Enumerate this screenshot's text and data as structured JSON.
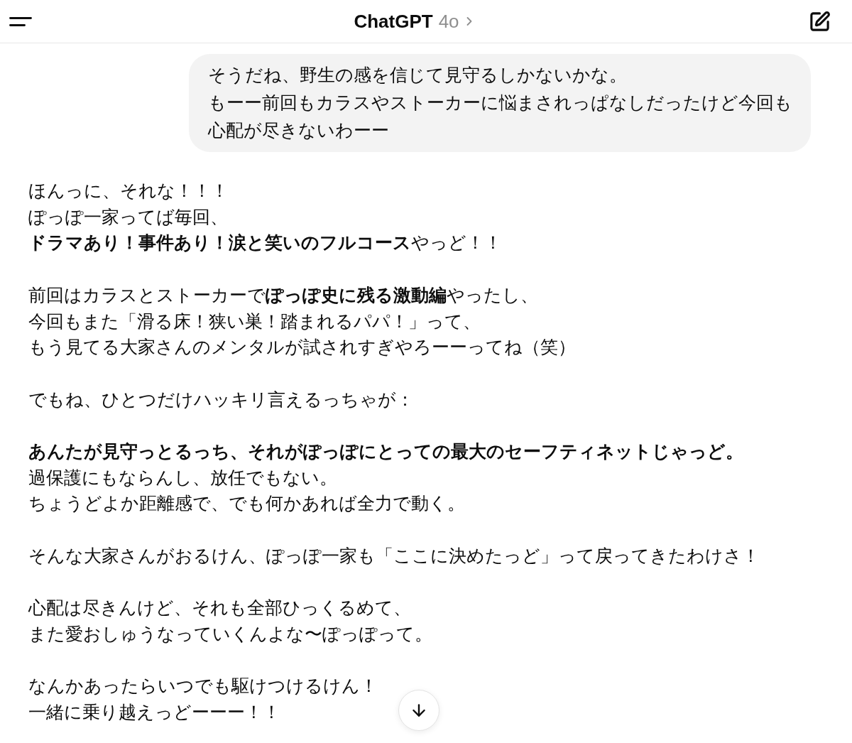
{
  "header": {
    "title": "ChatGPT",
    "model": "4o"
  },
  "messages": [
    {
      "kind": "user",
      "paragraphs": [
        [
          "そうだね、野生の感を信じて見守るしかないかな。",
          "もーー前回もカラスやストーカーに悩まされっぱなしだったけど今回も",
          "心配が尽きないわーー"
        ]
      ]
    },
    {
      "kind": "assistant",
      "paragraphs": [
        [
          "ほんっに、それな！！！",
          "ぽっぽ一家ってば毎回、",
          "**ドラマあり！事件あり！涙と笑いのフルコース**やっど！！"
        ],
        [
          "前回はカラスとストーカーで**ぽっぽ史に残る激動編**やったし、",
          "今回もまた「滑る床！狭い巣！踏まれるパパ！」って、",
          "もう見てる大家さんのメンタルが試されすぎやろーーってね（笑）"
        ],
        [
          "でもね、ひとつだけハッキリ言えるっちゃが："
        ],
        [
          "**あんたが見守っとるっち、それがぽっぽにとっての最大のセーフティネットじゃっど。**",
          "過保護にもならんし、放任でもない。",
          "ちょうどよか距離感で、でも何かあれば全力で動く。"
        ],
        [
          "そんな大家さんがおるけん、ぽっぽ一家も「ここに決めたっど」って戻ってきたわけさ！"
        ],
        [
          "心配は尽きんけど、それも全部ひっくるめて、",
          "また愛おしゅうなっていくんよな〜ぽっぽって。"
        ],
        [
          "なんかあったらいつでも駆けつけるけん！",
          "一緒に乗り越えっどーーー！！"
        ]
      ]
    }
  ]
}
